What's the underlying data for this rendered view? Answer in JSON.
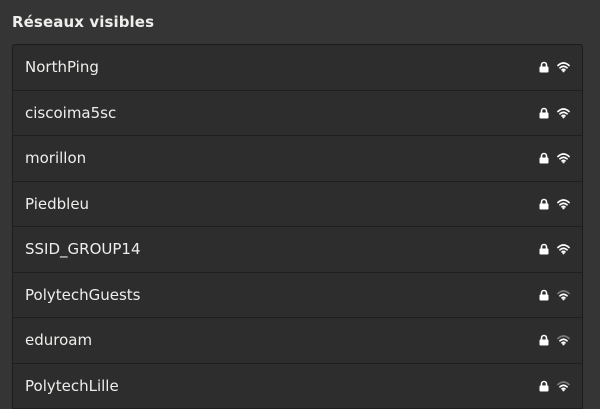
{
  "section": {
    "title": "Réseaux visibles"
  },
  "networks": [
    {
      "name": "NorthPing",
      "secured": true,
      "signal": "excellent",
      "icons": [
        "lock-icon",
        "wifi-signal-icon"
      ]
    },
    {
      "name": "ciscoima5sc",
      "secured": true,
      "signal": "excellent",
      "icons": [
        "lock-icon",
        "wifi-signal-icon"
      ]
    },
    {
      "name": "morillon",
      "secured": true,
      "signal": "excellent",
      "icons": [
        "lock-icon",
        "wifi-signal-icon"
      ]
    },
    {
      "name": "Piedbleu",
      "secured": true,
      "signal": "excellent",
      "icons": [
        "lock-icon",
        "wifi-signal-icon"
      ]
    },
    {
      "name": "SSID_GROUP14",
      "secured": true,
      "signal": "excellent",
      "icons": [
        "lock-icon",
        "wifi-signal-icon"
      ]
    },
    {
      "name": "PolytechGuests",
      "secured": true,
      "signal": "good",
      "icons": [
        "lock-icon",
        "wifi-signal-icon"
      ]
    },
    {
      "name": "eduroam",
      "secured": true,
      "signal": "good",
      "icons": [
        "lock-icon",
        "wifi-signal-icon"
      ]
    },
    {
      "name": "PolytechLille",
      "secured": true,
      "signal": "good",
      "icons": [
        "lock-icon",
        "wifi-signal-icon"
      ]
    }
  ],
  "colors": {
    "background": "#353535",
    "list_background": "#2d2d2d",
    "text": "#eeeeec",
    "icon_strong": "#ffffff",
    "icon_dim": "#7a7a7a"
  }
}
